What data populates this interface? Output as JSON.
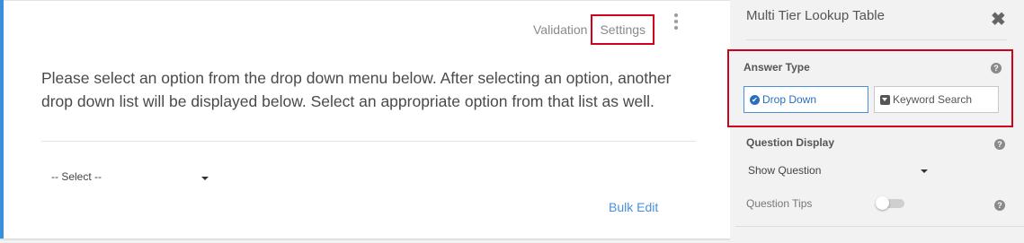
{
  "question_card": {
    "tabs": {
      "validation": "Validation",
      "settings": "Settings"
    },
    "question_text": "Please select an option from the drop down menu below. After selecting an option, another drop down list will be displayed below. Select an appropriate option from that list as well.",
    "select_placeholder": "-- Select --",
    "bulk_edit_label": "Bulk Edit"
  },
  "panel": {
    "title": "Multi Tier Lookup Table",
    "answer_type": {
      "label": "Answer Type",
      "options": [
        {
          "label": "Drop Down",
          "selected": true
        },
        {
          "label": "Keyword Search",
          "selected": false
        }
      ]
    },
    "question_display": {
      "label": "Question Display",
      "value": "Show Question"
    },
    "question_tips": {
      "label": "Question Tips",
      "enabled": false
    }
  },
  "colors": {
    "accent": "#3a8fd8",
    "highlight": "#d0021b",
    "link": "#4a90d9"
  },
  "icons": [
    "more-vertical-icon",
    "close-icon",
    "help-icon",
    "check-circle-icon",
    "dropdown-square-icon",
    "caret-down-icon"
  ]
}
